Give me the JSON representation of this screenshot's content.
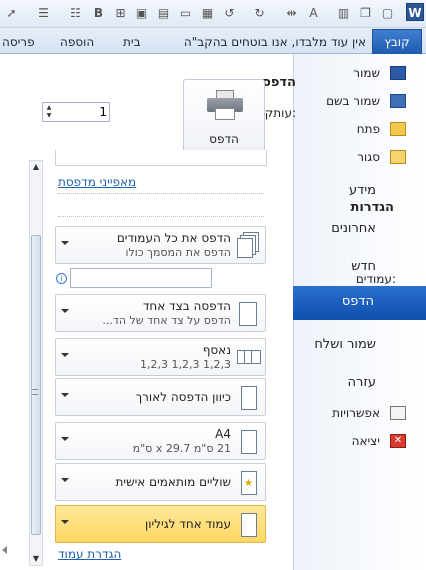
{
  "qat": {
    "bold_label": "B",
    "word_label": "W"
  },
  "tabs": {
    "file": "קובץ",
    "items": [
      "אין עוד מלבדו, אנו בוטחים בהקב\"ה",
      "בית",
      "הוספה",
      "פריסה"
    ]
  },
  "nav": {
    "save": "שמור",
    "save_as": "שמור בשם",
    "open": "פתח",
    "close": "סגור",
    "info": "מידע",
    "recent": "אחרונים",
    "new": "חדש",
    "print": "הדפס",
    "save_send": "שמור ושלח",
    "help": "עזרה",
    "options": "אפשרויות",
    "exit": "יציאה"
  },
  "print": {
    "title": "הדפסה",
    "copies_label": "עותקים:",
    "copies_value": "1",
    "button_label": "הדפס",
    "printer_props": "מאפייני מדפסת"
  },
  "settings": {
    "title": "הגדרות",
    "pages_label": "עמודים:",
    "pages_value": "",
    "info_icon": "i",
    "items": [
      {
        "line1": "הדפס את כל העמודים",
        "line2": "הדפס את המסמך כולו"
      },
      {
        "line1": "הדפסה בצד אחד",
        "line2": "הדפס על צד אחד של הד..."
      },
      {
        "line1": "נאסף",
        "line2": "1,2,3    1,2,3    1,2,3"
      },
      {
        "line1": "כיוון הדפסה לאורך"
      },
      {
        "line1": "A4",
        "line2": "21 ס\"מ x 29.7 ס\"מ"
      },
      {
        "line1": "שוליים מותאמים אישית"
      },
      {
        "line1": "עמוד אחד לגיליון"
      }
    ],
    "page_setup": "הגדרת עמוד"
  },
  "colors": {
    "accent": "#1f5bb0",
    "highlight": "#ffd862",
    "link": "#2060b0"
  }
}
